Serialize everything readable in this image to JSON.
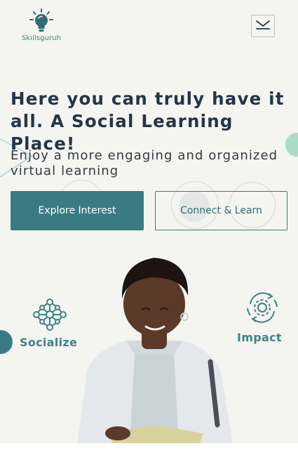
{
  "brand": {
    "name": "Skillsguruh",
    "icon": "lightbulb-icon"
  },
  "header": {
    "menu_icon": "chevron-down-icon"
  },
  "hero": {
    "headline": "Here you can truly have it all. A Social Learning Place!",
    "subheadline": "Enjoy a more engaging and organized virtual learning"
  },
  "buttons": {
    "explore": "Explore Interest",
    "connect": "Connect & Learn"
  },
  "features": {
    "socialize": {
      "label": "Socialize",
      "icon": "network-icon"
    },
    "impact": {
      "label": "Impact",
      "icon": "gear-cycle-icon"
    }
  },
  "colors": {
    "brand": "#3a7b83",
    "heading": "#233548",
    "background": "#f4f4f1",
    "accent_mint": "#a8dcc7"
  }
}
